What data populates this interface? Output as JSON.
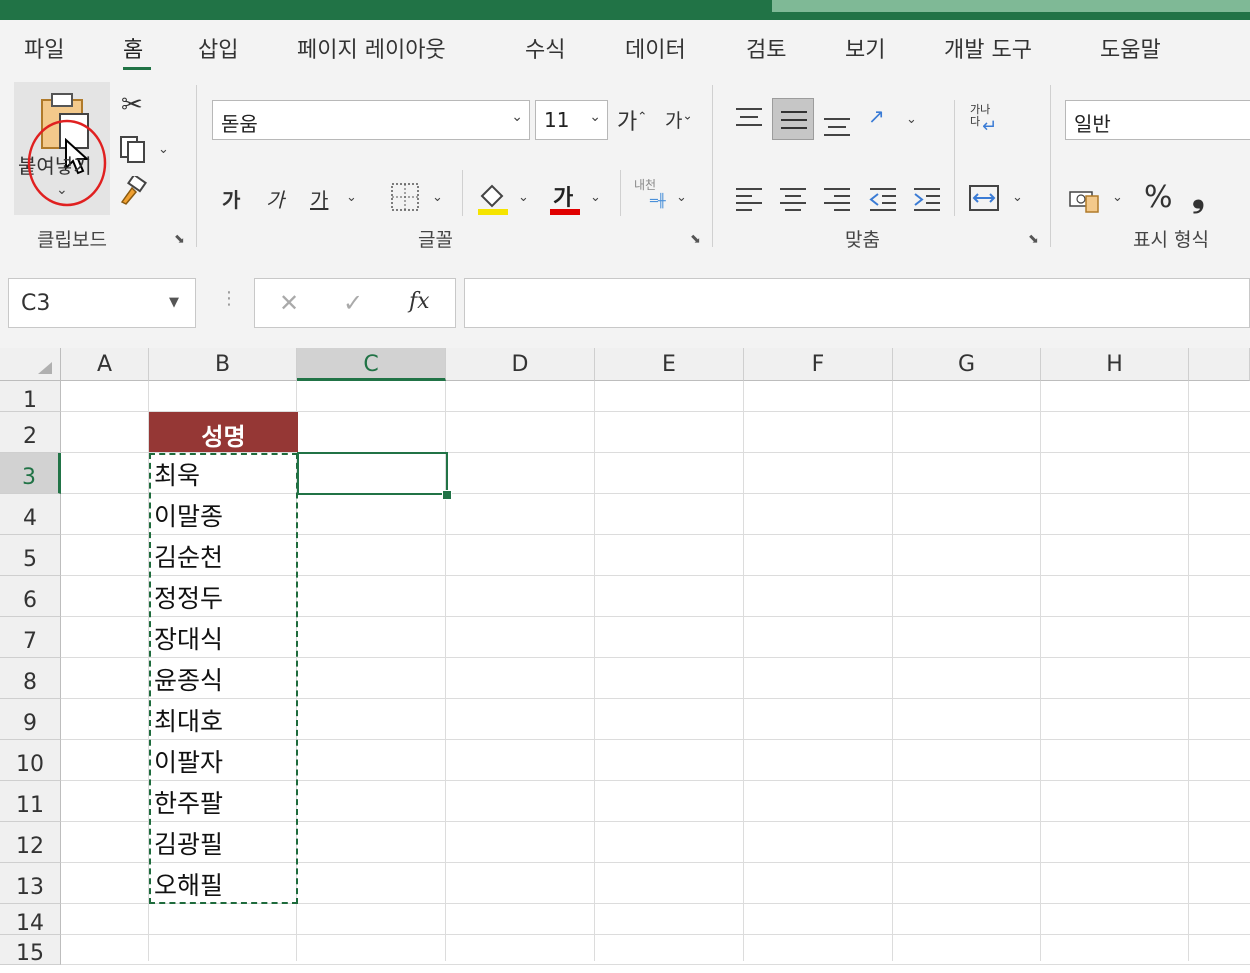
{
  "tabs": [
    "파일",
    "홈",
    "삽입",
    "페이지 레이아웃",
    "수식",
    "데이터",
    "검토",
    "보기",
    "개발 도구",
    "도움말"
  ],
  "clipboard": {
    "paste_label": "붙여넣기",
    "group_label": "클립보드"
  },
  "font": {
    "name": "돋움",
    "size": "11",
    "grow_label": "가",
    "shrink_label": "가",
    "bold_label": "가",
    "italic_label": "가",
    "underline_label": "가",
    "font_color_label": "가",
    "phonetic_label": "내천",
    "group_label": "글꼴",
    "fill_color": "#f5e400",
    "font_color": "#e00000"
  },
  "alignment": {
    "wrap_label": "가나다",
    "group_label": "맞춤"
  },
  "number": {
    "format": "일반",
    "percent": "%",
    "comma": "❟",
    "group_label": "표시 형식"
  },
  "name_box": "C3",
  "formula": {
    "fx": "fx",
    "cancel": "✕",
    "enter": "✓",
    "content": ""
  },
  "columns": [
    "A",
    "B",
    "C",
    "D",
    "E",
    "F",
    "G",
    "H"
  ],
  "rows": [
    "1",
    "2",
    "3",
    "4",
    "5",
    "6",
    "7",
    "8",
    "9",
    "10",
    "11",
    "12",
    "13",
    "14",
    "15"
  ],
  "selected_column": "C",
  "selected_row": "3",
  "header_cell": {
    "text": "성명",
    "fill": "#953735"
  },
  "names": [
    "최욱",
    "이말종",
    "김순천",
    "정정두",
    "장대식",
    "윤종식",
    "최대호",
    "이팔자",
    "한주팔",
    "김광필",
    "오해필"
  ],
  "colors": {
    "accent": "#217346",
    "highlight_circle": "#e02020"
  }
}
